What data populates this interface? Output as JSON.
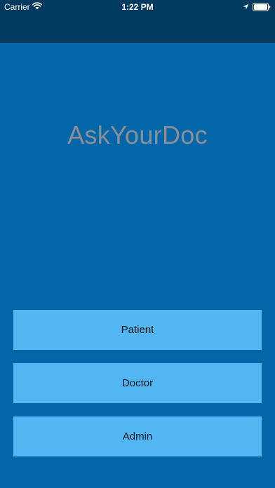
{
  "status_bar": {
    "carrier": "Carrier",
    "time": "1:22 PM",
    "icons": [
      "wifi-icon",
      "location-icon",
      "battery-icon"
    ]
  },
  "app": {
    "title": "AskYourDoc"
  },
  "buttons": {
    "patient_label": "Patient",
    "doctor_label": "Doctor",
    "admin_label": "Admin"
  },
  "colors": {
    "background": "#0266a8",
    "nav_bar": "#033a60",
    "button": "#51b6f1",
    "title_text": "#8a8f98"
  }
}
